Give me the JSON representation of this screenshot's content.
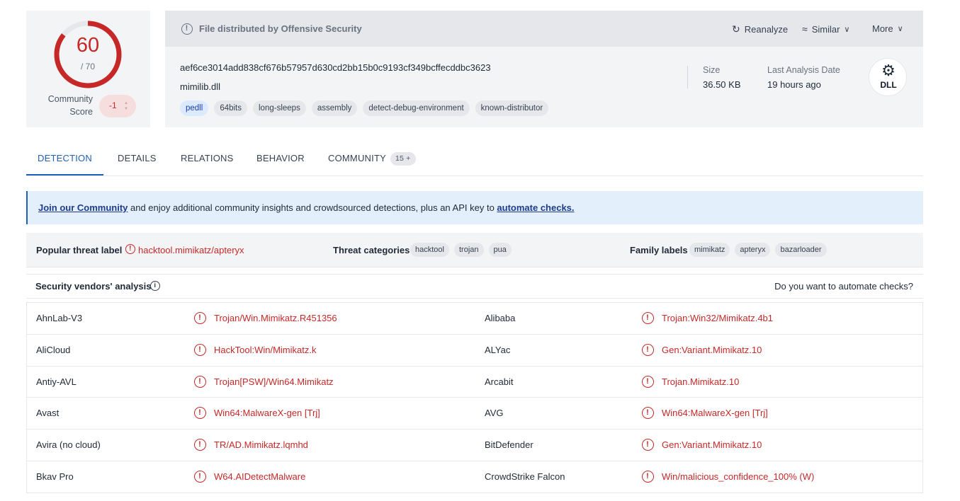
{
  "score": {
    "detections": "60",
    "total": "/ 70",
    "ratio": 0.857
  },
  "community": {
    "label": "Community Score",
    "value": "-1"
  },
  "file": {
    "distributed_by": "File distributed by Offensive Security",
    "hash": "aef6ce3014add838cf676b57957d630cd2bb15b0c9193cf349bcffecddbc3623",
    "name": "mimilib.dll",
    "tags": [
      "pedll",
      "64bits",
      "long-sleeps",
      "assembly",
      "detect-debug-environment",
      "known-distributor"
    ],
    "size_label": "Size",
    "size": "36.50 KB",
    "date_label": "Last Analysis Date",
    "date": "19 hours ago",
    "type_badge": "DLL"
  },
  "actions": {
    "reanalyze": "Reanalyze",
    "similar": "Similar",
    "more": "More"
  },
  "tabs": [
    {
      "label": "DETECTION"
    },
    {
      "label": "DETAILS"
    },
    {
      "label": "RELATIONS"
    },
    {
      "label": "BEHAVIOR"
    },
    {
      "label": "COMMUNITY",
      "count": "15 +"
    }
  ],
  "banner": {
    "join": "Join our Community",
    "middle": " and enjoy additional community insights and crowdsourced detections, plus an API key to ",
    "automate": "automate checks."
  },
  "threat": {
    "popular_label": "Popular threat label",
    "popular_value": "hacktool.mimikatz/apteryx",
    "categories_label": "Threat categories",
    "categories": [
      "hacktool",
      "trojan",
      "pua"
    ],
    "family_label": "Family labels",
    "families": [
      "mimikatz",
      "apteryx",
      "bazarloader"
    ]
  },
  "vendors_section": {
    "title": "Security vendors' analysis",
    "automate_text": "Do you want to automate checks?"
  },
  "vendor_rows": [
    {
      "v1": "AhnLab-V3",
      "d1": "Trojan/Win.Mimikatz.R451356",
      "v2": "Alibaba",
      "d2": "Trojan:Win32/Mimikatz.4b1"
    },
    {
      "v1": "AliCloud",
      "d1": "HackTool:Win/Mimikatz.k",
      "v2": "ALYac",
      "d2": "Gen:Variant.Mimikatz.10"
    },
    {
      "v1": "Antiy-AVL",
      "d1": "Trojan[PSW]/Win64.Mimikatz",
      "v2": "Arcabit",
      "d2": "Trojan.Mimikatz.10"
    },
    {
      "v1": "Avast",
      "d1": "Win64:MalwareX-gen [Trj]",
      "v2": "AVG",
      "d2": "Win64:MalwareX-gen [Trj]"
    },
    {
      "v1": "Avira (no cloud)",
      "d1": "TR/AD.Mimikatz.lqmhd",
      "v2": "BitDefender",
      "d2": "Gen:Variant.Mimikatz.10"
    },
    {
      "v1": "Bkav Pro",
      "d1": "W64.AIDetectMalware",
      "v2": "CrowdStrike Falcon",
      "d2": "Win/malicious_confidence_100% (W)"
    }
  ],
  "colors": {
    "malicious": "#c62828",
    "accent": "#1f5fb4",
    "banner_bg": "#e3f0fb"
  }
}
